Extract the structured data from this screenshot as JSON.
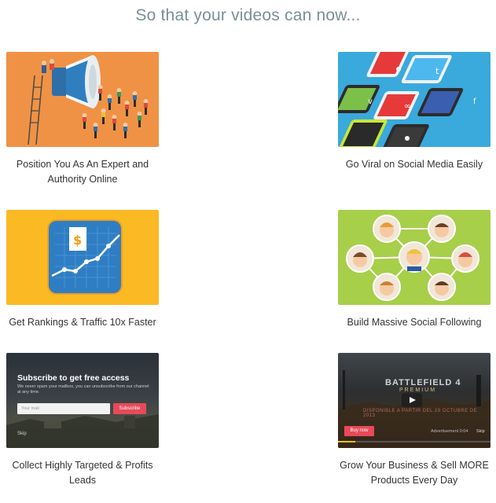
{
  "headline": "So that your videos can now...",
  "features": [
    {
      "caption": "Position You As An Expert and Authority Online",
      "icon": "megaphone-crowd-illustration",
      "color": "#ef9245"
    },
    {
      "caption": "Go Viral on Social Media Easily",
      "icon": "social-phones-illustration",
      "color": "#3aa9dc"
    },
    {
      "caption": "Get Rankings & Traffic 10x Faster",
      "icon": "growth-chart-illustration",
      "color": "#fbb924"
    },
    {
      "caption": "Build Massive Social Following",
      "icon": "social-network-people-illustration",
      "color": "#a7cf49"
    },
    {
      "caption": "Collect Highly Targeted & Profits Leads",
      "icon": "optin-form-screenshot",
      "color": "#2f353a"
    },
    {
      "caption": "Grow Your Business & Sell MORE Products Every Day",
      "icon": "video-ad-screenshot",
      "color": "#2b2d2e"
    }
  ],
  "optin": {
    "title": "Subscribe to get free access",
    "subtitle": "We never spam your mailbox, you can unsubscribe from our channel at any time.",
    "email_placeholder": "Your mail",
    "button": "Subscribe",
    "skip": "Skip"
  },
  "video": {
    "game_title": "BATTLEFIELD 4",
    "edition": "PREMIUM",
    "launch_text": "DISPONIBLE A PARTIR DEL 29 OCTUBRE DE 2013",
    "buy_button": "Buy now",
    "ad_label": "Advertisement 0:04",
    "skip": "Skip"
  },
  "colors": {
    "headline": "#7a8f95",
    "caption": "#333333",
    "accent_button": "#e74a5a"
  }
}
